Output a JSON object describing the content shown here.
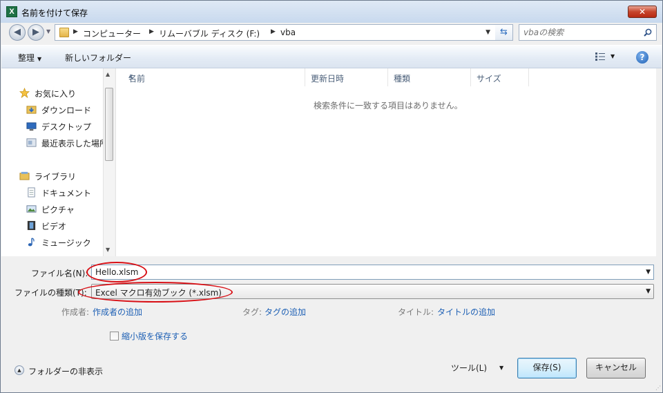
{
  "window": {
    "title": "名前を付けて保存",
    "app_icon": "X",
    "close": "✕"
  },
  "address": {
    "crumbs": [
      "コンピューター",
      "リムーバブル ディスク (F:)",
      "vba"
    ]
  },
  "search": {
    "placeholder": "vbaの検索"
  },
  "toolbar": {
    "organize": "整理",
    "new_folder": "新しいフォルダー",
    "help": "?"
  },
  "sidebar": {
    "items": [
      {
        "label": "お気に入り",
        "icon": "star-icon"
      },
      {
        "label": "ダウンロード",
        "icon": "downloads-folder-icon"
      },
      {
        "label": "デスクトップ",
        "icon": "desktop-icon"
      },
      {
        "label": "最近表示した場所",
        "icon": "recent-places-icon"
      },
      {
        "label": "ライブラリ",
        "icon": "library-icon"
      },
      {
        "label": "ドキュメント",
        "icon": "documents-icon"
      },
      {
        "label": "ピクチャ",
        "icon": "pictures-icon"
      },
      {
        "label": "ビデオ",
        "icon": "videos-icon"
      },
      {
        "label": "ミュージック",
        "icon": "music-icon"
      }
    ]
  },
  "filelist": {
    "columns": [
      "名前",
      "更新日時",
      "種類",
      "サイズ"
    ],
    "empty_message": "検索条件に一致する項目はありません。"
  },
  "form": {
    "filename_label": "ファイル名(N):",
    "filename_value": "Hello.xlsm",
    "filetype_label": "ファイルの種類(T):",
    "filetype_value": "Excel マクロ有効ブック (*.xlsm)",
    "author_label": "作成者:",
    "author_link": "作成者の追加",
    "tags_label": "タグ:",
    "tags_link": "タグの追加",
    "title_label": "タイトル:",
    "title_link": "タイトルの追加",
    "thumbnail_label": "縮小版を保存する",
    "thumbnail_checked": false
  },
  "footer": {
    "hide_folders": "フォルダーの非表示",
    "tools": "ツール(L)",
    "save": "保存(S)",
    "cancel": "キャンセル"
  },
  "colors": {
    "link": "#1c5fb4",
    "annotation": "#d80f15",
    "excel_green": "#1e7145"
  }
}
